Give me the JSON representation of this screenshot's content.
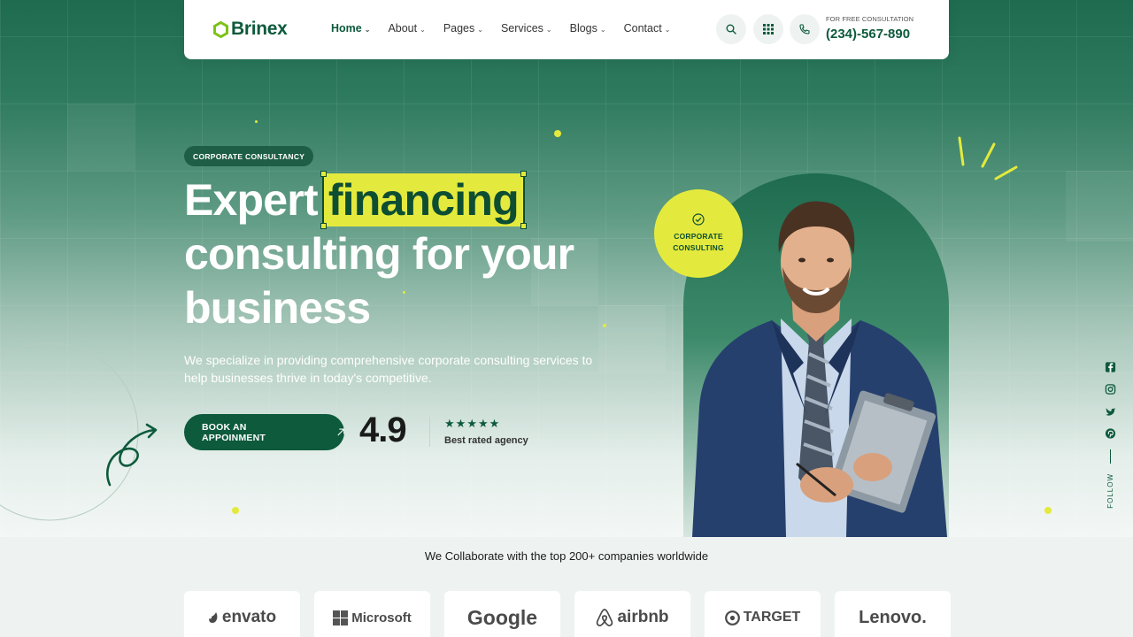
{
  "brand": {
    "name": "Brinex"
  },
  "nav": {
    "items": [
      {
        "label": "Home",
        "active": true
      },
      {
        "label": "About",
        "active": false
      },
      {
        "label": "Pages",
        "active": false
      },
      {
        "label": "Services",
        "active": false
      },
      {
        "label": "Blogs",
        "active": false
      },
      {
        "label": "Contact",
        "active": false
      }
    ],
    "icons": [
      "search-icon",
      "grid-icon",
      "phone-icon"
    ],
    "consult_label": "FOR FREE CONSULTATION",
    "consult_phone": "(234)-567-890"
  },
  "hero": {
    "badge": "CORPORATE CONSULTANCY",
    "headline_start": "Expert",
    "headline_highlight": "financing",
    "headline_line2": "consulting for your",
    "headline_line3": "business",
    "subtext": "We specialize in providing comprehensive corporate consulting services to help businesses thrive in today's competitive.",
    "cta_label": "BOOK AN APPOINMENT",
    "rating_value": "4.9",
    "rating_stars": 5,
    "rating_label": "Best rated agency",
    "circle_badge_line1": "CORPORATE",
    "circle_badge_line2": "CONSULTING"
  },
  "social": {
    "icons": [
      "facebook-icon",
      "instagram-icon",
      "twitter-icon",
      "pinterest-icon"
    ],
    "follow_label": "FOLLOW"
  },
  "partners": {
    "heading": "We Collaborate with the top 200+ companies worldwide",
    "logos": [
      "envato",
      "Microsoft",
      "Google",
      "airbnb",
      "TARGET",
      "Lenovo."
    ]
  },
  "colors": {
    "brand_green": "#0d5a3c",
    "accent_yellow": "#e4ea3d"
  }
}
